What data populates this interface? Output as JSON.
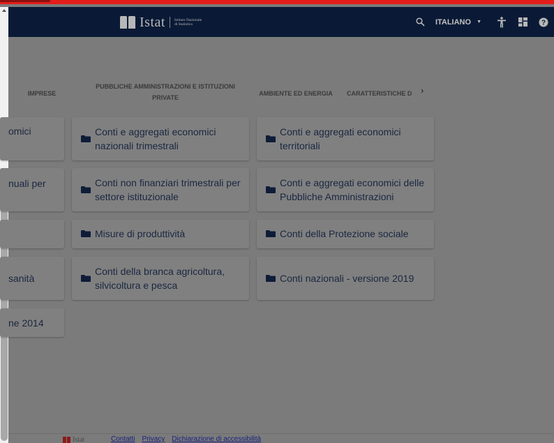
{
  "header": {
    "logo_word": "Istat",
    "logo_subtitle": "Istituto Nazionale di Statistica",
    "language": "ITALIANO",
    "icons": [
      "search-icon",
      "accessibility-icon",
      "dashboard-icon",
      "help-icon"
    ]
  },
  "tabs": [
    {
      "label": "IMPRESE"
    },
    {
      "label": "PUBBLICHE AMMINISTRAZIONI E ISTITUZIONI PRIVATE"
    },
    {
      "label": "AMBIENTE ED ENERGIA"
    },
    {
      "label": "CARATTERISTICHE D"
    }
  ],
  "cards": [
    {
      "label": "omici"
    },
    {
      "label": "Conti e aggregati economici nazionali trimestrali"
    },
    {
      "label": "Conti e aggregati economici territoriali"
    },
    {
      "label": "nuali per"
    },
    {
      "label": "Conti non finanziari trimestrali per settore istituzionale"
    },
    {
      "label": "Conti e aggregati economici delle Pubbliche Amministrazioni"
    },
    {
      "label": "Misure di produttività"
    },
    {
      "label": "Conti della Protezione sociale"
    },
    {
      "label": "sanità"
    },
    {
      "label": "Conti della branca agricoltura, silvicoltura e pesca"
    },
    {
      "label": "Conti nazionali - versione 2019"
    },
    {
      "label": "ne 2014"
    }
  ],
  "footer": {
    "logo_word": "Istat",
    "links": [
      "Contatti",
      "Privacy",
      "Dichiarazione di accessibilità"
    ]
  },
  "colors": {
    "header_bg": "#0a1a36",
    "accent_red": "#e31d1a",
    "overlay_bg": "#7b7b7b",
    "card_text": "#1a2740",
    "folder": "#0e1c38"
  }
}
